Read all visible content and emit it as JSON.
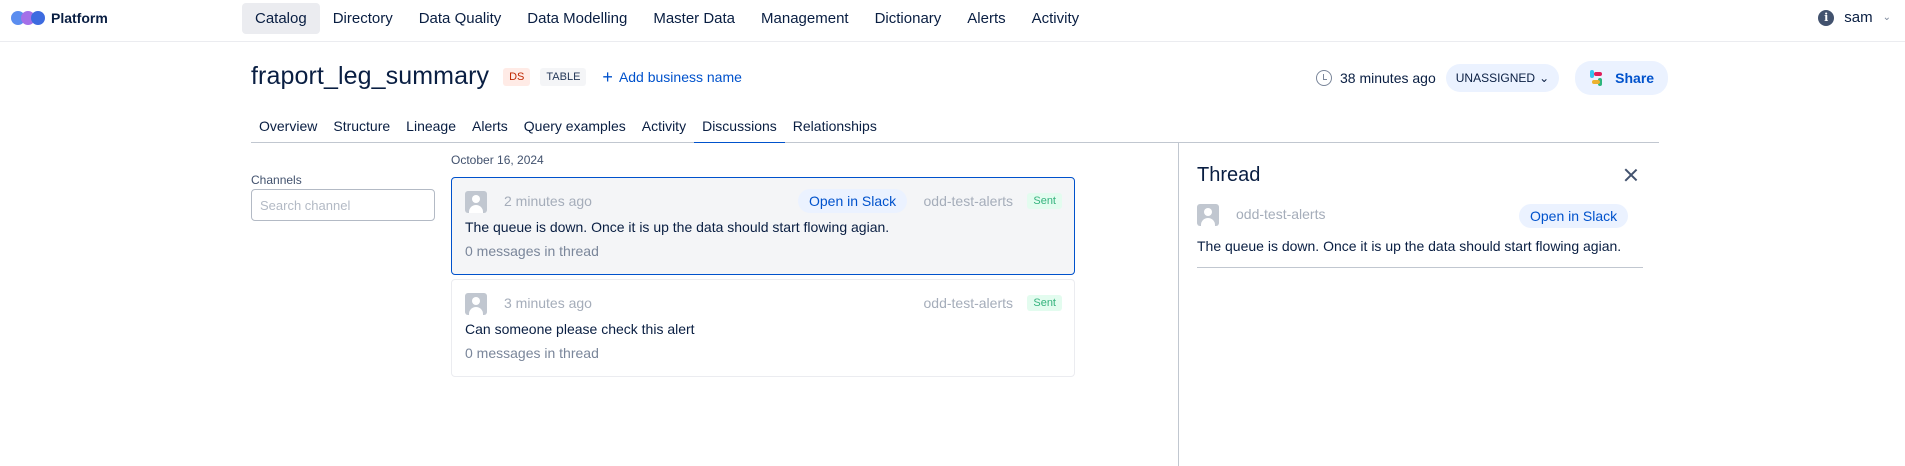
{
  "app": {
    "name": "Platform"
  },
  "nav": {
    "items": [
      "Catalog",
      "Directory",
      "Data Quality",
      "Data Modelling",
      "Master Data",
      "Management",
      "Dictionary",
      "Alerts",
      "Activity"
    ],
    "active": "Catalog"
  },
  "user": {
    "name": "sam"
  },
  "entity": {
    "name": "fraport_leg_summary",
    "source_badge": "DS",
    "type_badge": "TABLE",
    "add_business_name": "Add business name",
    "updated": "38 minutes ago",
    "owner_status": "UNASSIGNED",
    "share_label": "Share"
  },
  "tabs": {
    "items": [
      "Overview",
      "Structure",
      "Lineage",
      "Alerts",
      "Query examples",
      "Activity",
      "Discussions",
      "Relationships"
    ],
    "active": "Discussions"
  },
  "channels": {
    "label": "Channels",
    "search_placeholder": "Search channel"
  },
  "messages": {
    "date": "October 16, 2024",
    "items": [
      {
        "time": "2 minutes ago",
        "open_slack": "Open in Slack",
        "channel": "odd-test-alerts",
        "status": "Sent",
        "text": "The queue is down. Once it is up the data should start flowing agian.",
        "thread_count": "0 messages in thread"
      },
      {
        "time": "3 minutes ago",
        "channel": "odd-test-alerts",
        "status": "Sent",
        "text": "Can someone please check this alert",
        "thread_count": "0 messages in thread"
      }
    ]
  },
  "thread": {
    "title": "Thread",
    "channel": "odd-test-alerts",
    "open_slack": "Open in Slack",
    "text": "The queue is down. Once it is up the data should start flowing agian."
  },
  "colors": {
    "accent": "#0052CC",
    "status_sent": "#36B37E",
    "source_badge": "#BF2600"
  }
}
